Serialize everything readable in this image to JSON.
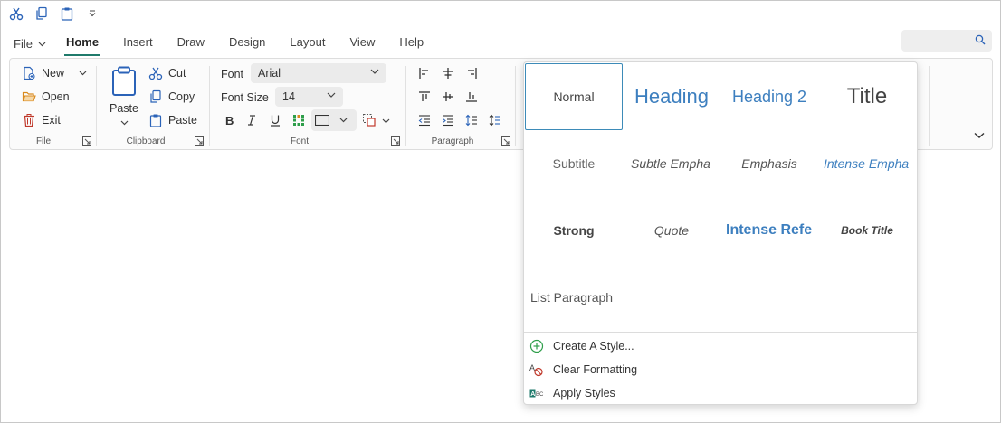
{
  "quick_access": {
    "icons": [
      "cut-icon",
      "copy-icon",
      "paste-icon",
      "customize-dropdown-icon"
    ]
  },
  "tabs": [
    {
      "label": "File"
    },
    {
      "label": "Home"
    },
    {
      "label": "Insert"
    },
    {
      "label": "Draw"
    },
    {
      "label": "Design"
    },
    {
      "label": "Layout"
    },
    {
      "label": "View"
    },
    {
      "label": "Help"
    }
  ],
  "search": {
    "placeholder": ""
  },
  "ribbon": {
    "file_group": {
      "label": "File",
      "new": "New",
      "open": "Open",
      "exit": "Exit"
    },
    "clipboard_group": {
      "label": "Clipboard",
      "paste": "Paste",
      "cut": "Cut",
      "copy": "Copy",
      "paste_small": "Paste"
    },
    "font_group": {
      "label": "Font",
      "font_label": "Font",
      "font_value": "Arial",
      "size_label": "Font Size",
      "size_value": "14"
    },
    "paragraph_group": {
      "label": "Paragraph"
    }
  },
  "styles_gallery": {
    "styles": [
      {
        "name": "Normal"
      },
      {
        "name": "Heading"
      },
      {
        "name": "Heading 2"
      },
      {
        "name": "Title"
      },
      {
        "name": "Subtitle"
      },
      {
        "name": "Subtle Empha"
      },
      {
        "name": "Emphasis"
      },
      {
        "name": "Intense Empha"
      },
      {
        "name": "Strong"
      },
      {
        "name": "Quote"
      },
      {
        "name": "Intense Refe"
      },
      {
        "name": "Book Title"
      },
      {
        "name": "List Paragraph"
      }
    ],
    "selected": "Normal",
    "menu": {
      "create": "Create A Style...",
      "clear": "Clear Formatting",
      "apply": "Apply Styles"
    }
  },
  "colors": {
    "accent": "#1f7a6b",
    "heading_blue": "#3d7fbf",
    "icon_blue": "#2b63b8",
    "icon_red": "#c0392b",
    "icon_orange": "#d98a1c"
  }
}
